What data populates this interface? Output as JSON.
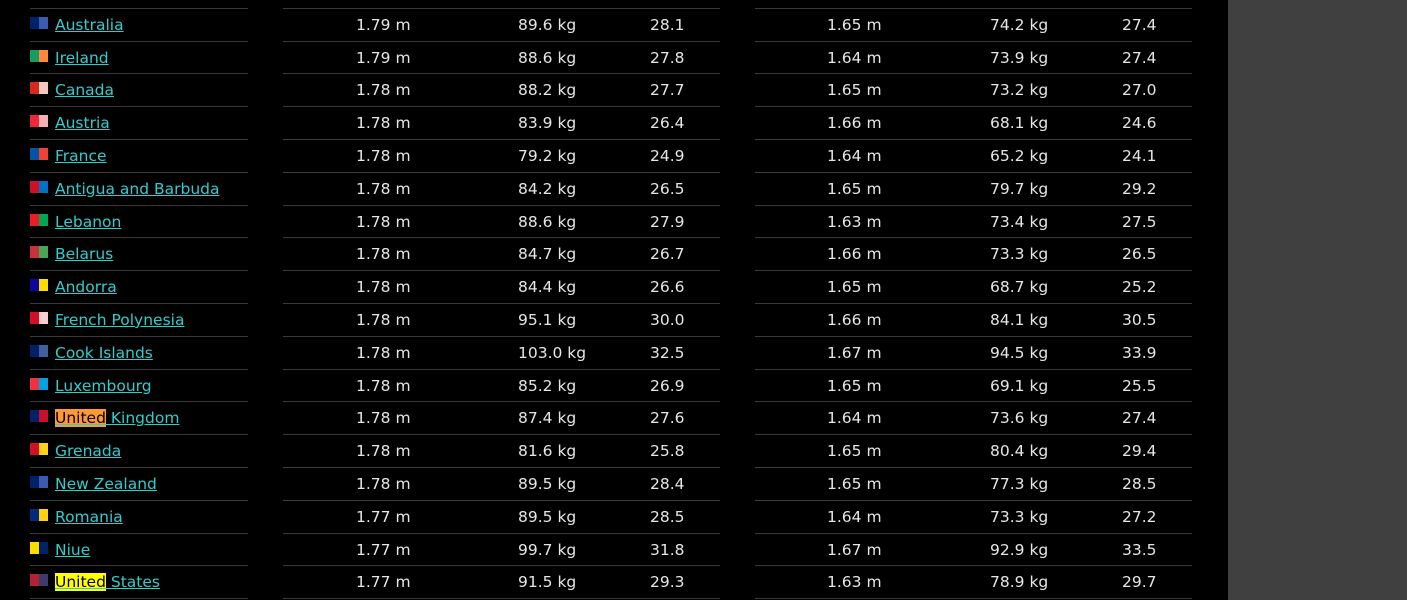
{
  "colors": {
    "link": "#33cccc",
    "highlight_orange": "#ff9933",
    "highlight_yellow": "#ffff00",
    "background": "#000000",
    "gutter": "#404040"
  },
  "rows": [
    {
      "country": "",
      "flag": [
        "#8b1c1c",
        "#8b1c1c"
      ],
      "m_height": "",
      "m_weight": "",
      "m_bmi": "",
      "f_height": "",
      "f_weight": "",
      "f_bmi": ""
    },
    {
      "country": "Australia",
      "flag": [
        "#012169",
        "#3a5bb0"
      ],
      "m_height": "1.79 m",
      "m_weight": "89.6 kg",
      "m_bmi": "28.1",
      "f_height": "1.65 m",
      "f_weight": "74.2 kg",
      "f_bmi": "27.4"
    },
    {
      "country": "Ireland",
      "flag": [
        "#169b62",
        "#ff883e"
      ],
      "m_height": "1.79 m",
      "m_weight": "88.6 kg",
      "m_bmi": "27.8",
      "f_height": "1.64 m",
      "f_weight": "73.9 kg",
      "f_bmi": "27.4"
    },
    {
      "country": "Canada",
      "flag": [
        "#d52b1e",
        "#f4c7c3"
      ],
      "m_height": "1.78 m",
      "m_weight": "88.2 kg",
      "m_bmi": "27.7",
      "f_height": "1.65 m",
      "f_weight": "73.2 kg",
      "f_bmi": "27.0"
    },
    {
      "country": "Austria",
      "flag": [
        "#ed2939",
        "#f5b0b6"
      ],
      "m_height": "1.78 m",
      "m_weight": "83.9 kg",
      "m_bmi": "26.4",
      "f_height": "1.66 m",
      "f_weight": "68.1 kg",
      "f_bmi": "24.6"
    },
    {
      "country": "France",
      "flag": [
        "#0055a4",
        "#ef4135"
      ],
      "m_height": "1.78 m",
      "m_weight": "79.2 kg",
      "m_bmi": "24.9",
      "f_height": "1.64 m",
      "f_weight": "65.2 kg",
      "f_bmi": "24.1"
    },
    {
      "country": "Antigua and Barbuda",
      "flag": [
        "#ce1126",
        "#0072c6"
      ],
      "m_height": "1.78 m",
      "m_weight": "84.2 kg",
      "m_bmi": "26.5",
      "f_height": "1.65 m",
      "f_weight": "79.7 kg",
      "f_bmi": "29.2"
    },
    {
      "country": "Lebanon",
      "flag": [
        "#ed1c24",
        "#00a651"
      ],
      "m_height": "1.78 m",
      "m_weight": "88.6 kg",
      "m_bmi": "27.9",
      "f_height": "1.63 m",
      "f_weight": "73.4 kg",
      "f_bmi": "27.5"
    },
    {
      "country": "Belarus",
      "flag": [
        "#c8313e",
        "#4aa657"
      ],
      "m_height": "1.78 m",
      "m_weight": "84.7 kg",
      "m_bmi": "26.7",
      "f_height": "1.66 m",
      "f_weight": "73.3 kg",
      "f_bmi": "26.5"
    },
    {
      "country": "Andorra",
      "flag": [
        "#10069f",
        "#fedd00"
      ],
      "m_height": "1.78 m",
      "m_weight": "84.4 kg",
      "m_bmi": "26.6",
      "f_height": "1.65 m",
      "f_weight": "68.7 kg",
      "f_bmi": "25.2"
    },
    {
      "country": "French Polynesia",
      "flag": [
        "#ce1126",
        "#f8d0d4"
      ],
      "m_height": "1.78 m",
      "m_weight": "95.1 kg",
      "m_bmi": "30.0",
      "f_height": "1.66 m",
      "f_weight": "84.1 kg",
      "f_bmi": "30.5"
    },
    {
      "country": "Cook Islands",
      "flag": [
        "#012169",
        "#4060a0"
      ],
      "m_height": "1.78 m",
      "m_weight": "103.0 kg",
      "m_bmi": "32.5",
      "f_height": "1.67 m",
      "f_weight": "94.5 kg",
      "f_bmi": "33.9"
    },
    {
      "country": "Luxembourg",
      "flag": [
        "#ef3340",
        "#00a3e0"
      ],
      "m_height": "1.78 m",
      "m_weight": "85.2 kg",
      "m_bmi": "26.9",
      "f_height": "1.65 m",
      "f_weight": "69.1 kg",
      "f_bmi": "25.5"
    },
    {
      "country": "United Kingdom",
      "highlight": "United",
      "highlight_color": "#ff9933",
      "flag": [
        "#012169",
        "#c8102e"
      ],
      "m_height": "1.78 m",
      "m_weight": "87.4 kg",
      "m_bmi": "27.6",
      "f_height": "1.64 m",
      "f_weight": "73.6 kg",
      "f_bmi": "27.4"
    },
    {
      "country": "Grenada",
      "flag": [
        "#ce1126",
        "#fcd116"
      ],
      "m_height": "1.78 m",
      "m_weight": "81.6 kg",
      "m_bmi": "25.8",
      "f_height": "1.65 m",
      "f_weight": "80.4 kg",
      "f_bmi": "29.4"
    },
    {
      "country": "New Zealand",
      "flag": [
        "#012169",
        "#3a5bb0"
      ],
      "m_height": "1.78 m",
      "m_weight": "89.5 kg",
      "m_bmi": "28.4",
      "f_height": "1.65 m",
      "f_weight": "77.3 kg",
      "f_bmi": "28.5"
    },
    {
      "country": "Romania",
      "flag": [
        "#002b7f",
        "#fcd116"
      ],
      "m_height": "1.77 m",
      "m_weight": "89.5 kg",
      "m_bmi": "28.5",
      "f_height": "1.64 m",
      "f_weight": "73.3 kg",
      "f_bmi": "27.2"
    },
    {
      "country": "Niue",
      "flag": [
        "#fedd00",
        "#012169"
      ],
      "m_height": "1.77 m",
      "m_weight": "99.7 kg",
      "m_bmi": "31.8",
      "f_height": "1.67 m",
      "f_weight": "92.9 kg",
      "f_bmi": "33.5"
    },
    {
      "country": "United States",
      "highlight": "United",
      "highlight_color": "#ffff00",
      "flag": [
        "#b22234",
        "#3c3b6e"
      ],
      "m_height": "1.77 m",
      "m_weight": "91.5 kg",
      "m_bmi": "29.3",
      "f_height": "1.63 m",
      "f_weight": "78.9 kg",
      "f_bmi": "29.7"
    }
  ]
}
